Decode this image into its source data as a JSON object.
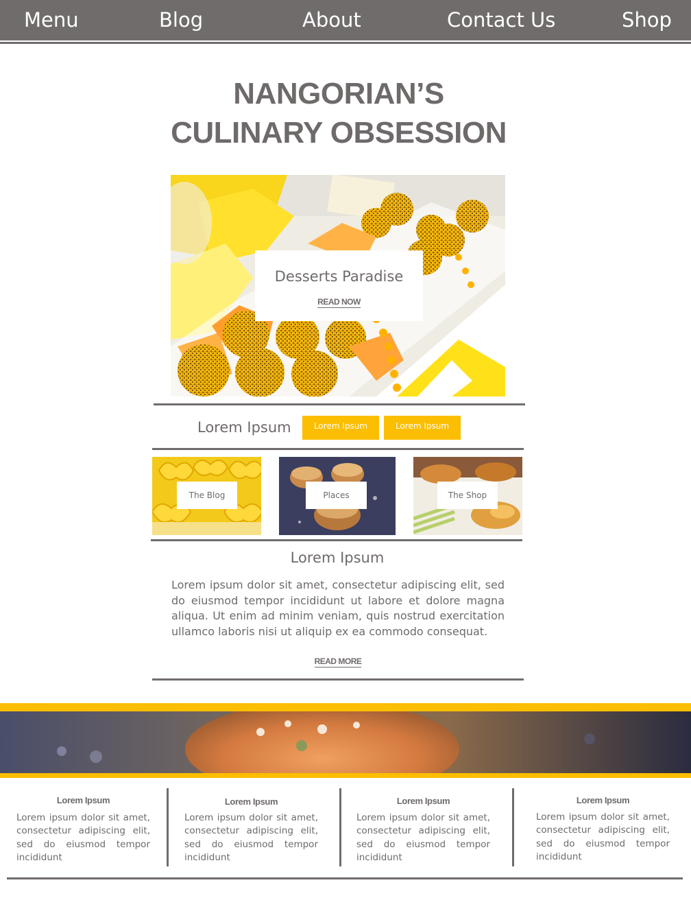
{
  "nav": {
    "items": [
      "Menu",
      "Blog",
      "About",
      "Contact Us",
      "Shop"
    ]
  },
  "title": {
    "line1": "NANGORIAN’S",
    "line2": "CULINARY OBSESSION"
  },
  "hero": {
    "card_title": "Desserts Paradise",
    "card_link": "READ NOW"
  },
  "categories": {
    "label": "Lorem Ipsum",
    "buttons": [
      "Lorem Ipsum",
      "Lorem Ipsum"
    ]
  },
  "thumbs": [
    "The Blog",
    "Places",
    "The Shop"
  ],
  "article": {
    "title": "Lorem Ipsum",
    "body": "Lorem ipsum dolor sit amet, consectetur adipiscing elit, sed do eiusmod tempor incididunt ut labore et dolore magna aliqua. Ut enim ad minim veniam, quis nostrud exercitation ullamco laboris nisi ut aliquip ex ea commodo consequat.",
    "link": "READ MORE"
  },
  "footer": {
    "columns": [
      {
        "title": "Lorem Ipsum",
        "body": "Lorem ipsum dolor sit amet, consectetur adipiscing elit, sed do eiusmod tempor incididunt"
      },
      {
        "title": "Lorem Ipsum",
        "body": "Lorem ipsum dolor sit amet, consectetur adipiscing elit, sed do eiusmod tempor incididunt"
      },
      {
        "title": "Lorem Ipsum",
        "body": "Lorem ipsum dolor sit amet, consectetur adipiscing elit, sed do eiusmod tempor incididunt"
      },
      {
        "title": "Lorem Ipsum",
        "body": "Lorem ipsum dolor sit amet, consectetur adipiscing elit, sed do eiusmod tempor incididunt"
      }
    ]
  },
  "colors": {
    "nav_bg": "#716c6c",
    "accent_yellow": "#fbbe00",
    "text_gray": "#6f6a6a"
  }
}
